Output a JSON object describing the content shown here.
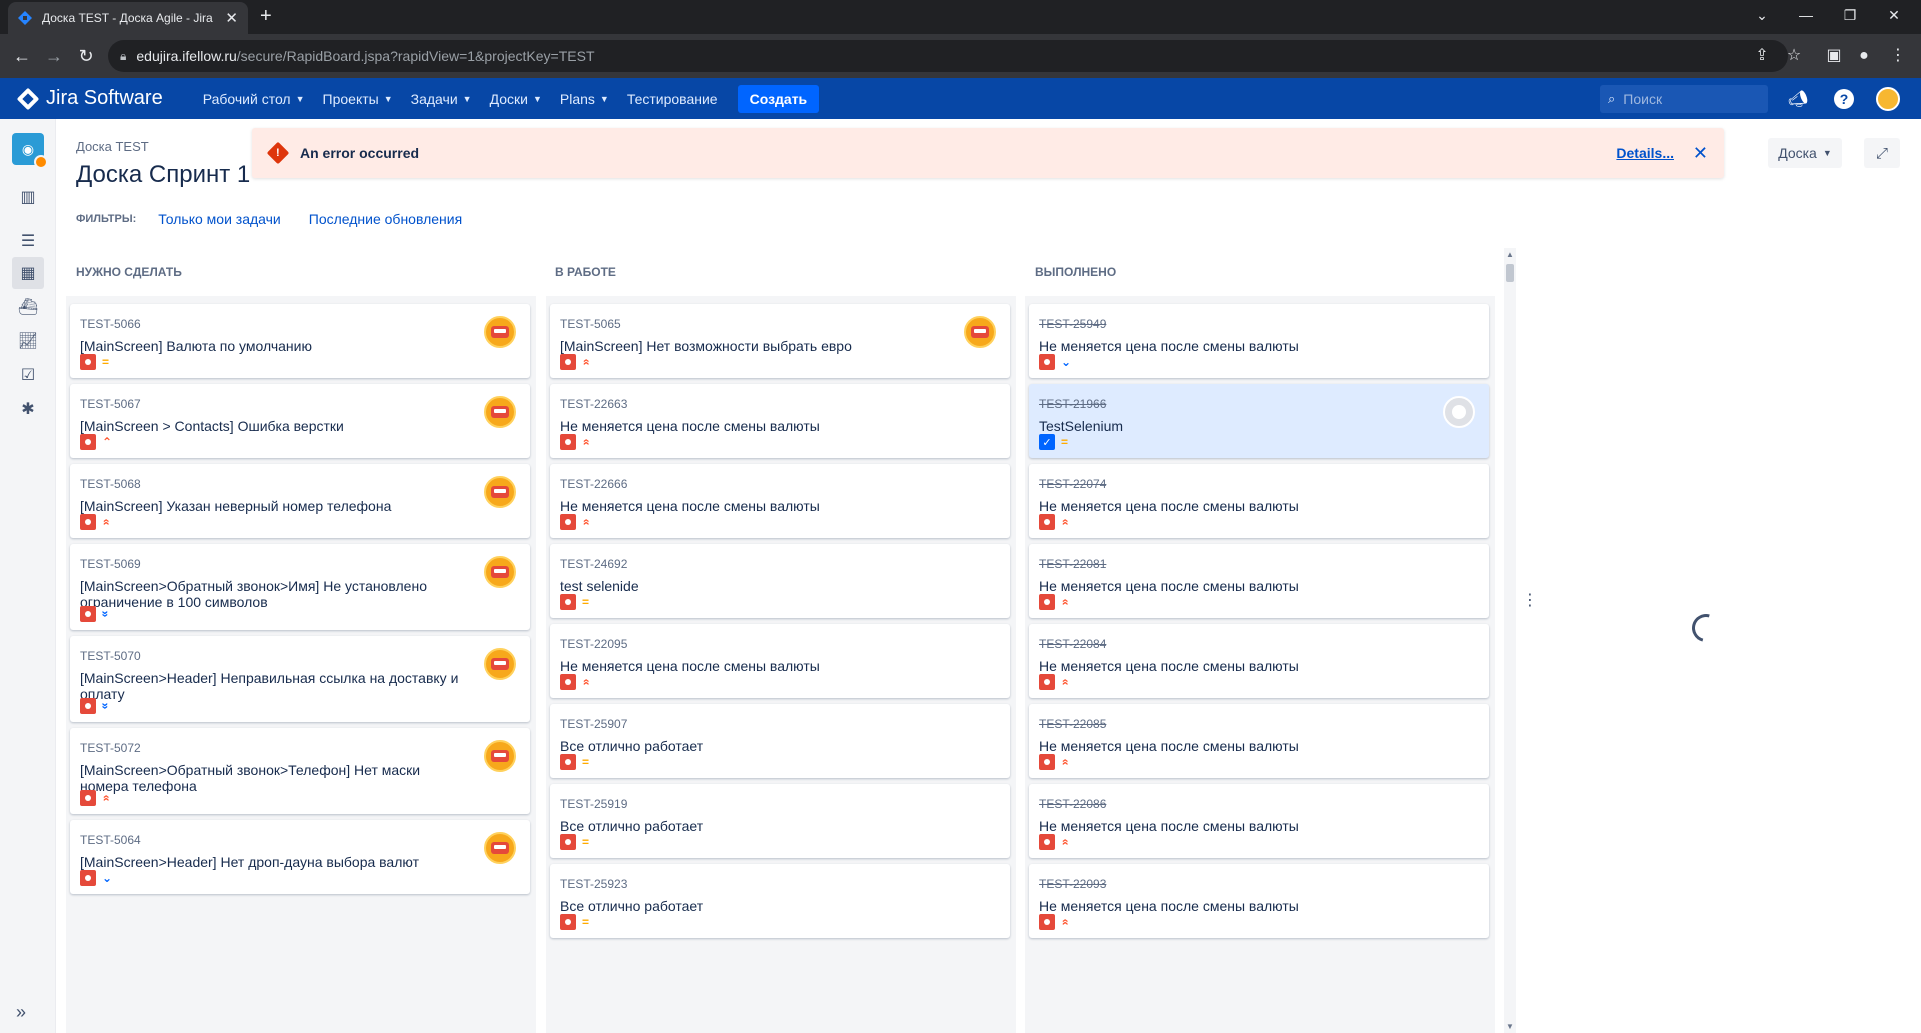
{
  "browser": {
    "tab_title": "Доска TEST - Доска Agile - Jira",
    "url_host": "edujira.ifellow.ru",
    "url_path": "/secure/RapidBoard.jspa?rapidView=1&projectKey=TEST"
  },
  "jira": {
    "product": "Jira Software",
    "menu": [
      "Рабочий стол",
      "Проекты",
      "Задачи",
      "Доски",
      "Plans",
      "Тестирование"
    ],
    "menu_has_caret": [
      true,
      true,
      true,
      true,
      true,
      false
    ],
    "create_label": "Создать",
    "search_placeholder": "Поиск"
  },
  "header": {
    "breadcrumb": "Доска TEST",
    "title": "Доска Спринт 1",
    "filters_label": "ФИЛЬТРЫ:",
    "filters": [
      "Только мои задачи",
      "Последние обновления"
    ],
    "board_button": "Доска"
  },
  "flag": {
    "message": "An error occurred",
    "details": "Details..."
  },
  "colors": {
    "brand": "#0747a6",
    "bug": "#e5493a",
    "error_bg": "#ffebe6",
    "link": "#0052cc"
  },
  "columns": [
    {
      "title": "НУЖНО СДЕЛАТЬ",
      "cards": [
        {
          "key": "TEST-5066",
          "summary": "[MainScreen] Валюта по умолчанию",
          "priority": "medium",
          "avatar": "user",
          "type": "bug",
          "done": false,
          "selected": false
        },
        {
          "key": "TEST-5067",
          "summary": "[MainScreen > Contacts] Ошибка верстки",
          "priority": "high",
          "avatar": "user",
          "type": "bug",
          "done": false,
          "selected": false
        },
        {
          "key": "TEST-5068",
          "summary": "[MainScreen] Указан неверный номер телефона",
          "priority": "highest",
          "avatar": "user",
          "type": "bug",
          "done": false,
          "selected": false
        },
        {
          "key": "TEST-5069",
          "summary": "[MainScreen>Обратный звонок>Имя] Не установлено ограничение в 100 символов",
          "priority": "lowest",
          "avatar": "user",
          "type": "bug",
          "done": false,
          "selected": false
        },
        {
          "key": "TEST-5070",
          "summary": "[MainScreen>Header] Неправильная ссылка на доставку и оплату",
          "priority": "lowest",
          "avatar": "user",
          "type": "bug",
          "done": false,
          "selected": false
        },
        {
          "key": "TEST-5072",
          "summary": "[MainScreen>Обратный звонок>Телефон] Нет маски номера телефона",
          "priority": "highest",
          "avatar": "user",
          "type": "bug",
          "done": false,
          "selected": false
        },
        {
          "key": "TEST-5064",
          "summary": "[MainScreen>Header] Нет дроп-дауна выбора валют",
          "priority": "low",
          "avatar": "user",
          "type": "bug",
          "done": false,
          "selected": false
        }
      ]
    },
    {
      "title": "В РАБОТЕ",
      "cards": [
        {
          "key": "TEST-5065",
          "summary": "[MainScreen] Нет возможности выбрать евро",
          "priority": "highest",
          "avatar": "user",
          "type": "bug",
          "done": false,
          "selected": false
        },
        {
          "key": "TEST-22663",
          "summary": "Не меняется цена после смены валюты",
          "priority": "highest",
          "avatar": "",
          "type": "bug",
          "done": false,
          "selected": false
        },
        {
          "key": "TEST-22666",
          "summary": "Не меняется цена после смены валюты",
          "priority": "highest",
          "avatar": "",
          "type": "bug",
          "done": false,
          "selected": false
        },
        {
          "key": "TEST-24692",
          "summary": "test selenide",
          "priority": "medium",
          "avatar": "",
          "type": "bug",
          "done": false,
          "selected": false
        },
        {
          "key": "TEST-22095",
          "summary": "Не меняется цена после смены валюты",
          "priority": "highest",
          "avatar": "",
          "type": "bug",
          "done": false,
          "selected": false
        },
        {
          "key": "TEST-25907",
          "summary": "Все отлично работает",
          "priority": "medium",
          "avatar": "",
          "type": "bug",
          "done": false,
          "selected": false
        },
        {
          "key": "TEST-25919",
          "summary": "Все отлично работает",
          "priority": "medium",
          "avatar": "",
          "type": "bug",
          "done": false,
          "selected": false
        },
        {
          "key": "TEST-25923",
          "summary": "Все отлично работает",
          "priority": "medium",
          "avatar": "",
          "type": "bug",
          "done": false,
          "selected": false
        }
      ]
    },
    {
      "title": "ВЫПОЛНЕНО",
      "cards": [
        {
          "key": "TEST-25949",
          "summary": "Не меняется цена после смены валюты",
          "priority": "low",
          "avatar": "",
          "type": "bug",
          "done": true,
          "selected": false
        },
        {
          "key": "TEST-21966",
          "summary": "TestSelenium",
          "priority": "medium",
          "avatar": "anon",
          "type": "task",
          "done": true,
          "selected": true
        },
        {
          "key": "TEST-22074",
          "summary": "Не меняется цена после смены валюты",
          "priority": "highest",
          "avatar": "",
          "type": "bug",
          "done": true,
          "selected": false
        },
        {
          "key": "TEST-22081",
          "summary": "Не меняется цена после смены валюты",
          "priority": "highest",
          "avatar": "",
          "type": "bug",
          "done": true,
          "selected": false
        },
        {
          "key": "TEST-22084",
          "summary": "Не меняется цена после смены валюты",
          "priority": "highest",
          "avatar": "",
          "type": "bug",
          "done": true,
          "selected": false
        },
        {
          "key": "TEST-22085",
          "summary": "Не меняется цена после смены валюты",
          "priority": "highest",
          "avatar": "",
          "type": "bug",
          "done": true,
          "selected": false
        },
        {
          "key": "TEST-22086",
          "summary": "Не меняется цена после смены валюты",
          "priority": "highest",
          "avatar": "",
          "type": "bug",
          "done": true,
          "selected": false
        },
        {
          "key": "TEST-22093",
          "summary": "Не меняется цена после смены валюты",
          "priority": "highest",
          "avatar": "",
          "type": "bug",
          "done": true,
          "selected": false
        }
      ]
    }
  ],
  "icons": {
    "priority": {
      "highest": "»",
      "high": "⌃",
      "medium": "=",
      "low": "⌄",
      "lowest": "»"
    }
  }
}
